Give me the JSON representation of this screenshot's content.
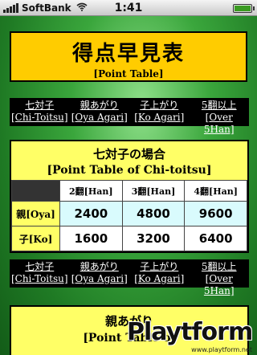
{
  "status": {
    "carrier": "SoftBank",
    "time": "1:41"
  },
  "title": {
    "jp": "得点早見表",
    "en": "[Point Table]"
  },
  "nav": [
    {
      "jp": "七対子",
      "en": "[Chi-Toitsu]"
    },
    {
      "jp": "親あがり",
      "en": "[Oya Agari]"
    },
    {
      "jp": "子上がり",
      "en": "[Ko Agari]"
    },
    {
      "jp": "5翻以上",
      "en": "[Over 5Han]"
    }
  ],
  "chitoitsu": {
    "title_jp": "七対子の場合",
    "title_en": "[Point Table of Chi-toitsu]",
    "columns": [
      "2翻[Han]",
      "3翻[Han]",
      "4翻[Han]"
    ],
    "rows": [
      {
        "label": "親[Oya]",
        "values": [
          "2400",
          "4800",
          "9600"
        ]
      },
      {
        "label": "子[Ko]",
        "values": [
          "1600",
          "3200",
          "6400"
        ]
      }
    ]
  },
  "oya": {
    "title_jp": "親あがり",
    "title_en": "[Point Table of"
  },
  "watermark": {
    "logo": "Playtform",
    "url": "www.playtform.net"
  },
  "colors": {
    "title_bg": "#ffcc00",
    "section_bg": "#ffff66",
    "oya_row_bg": "#d9fbfd",
    "nav_bg": "#000000"
  }
}
